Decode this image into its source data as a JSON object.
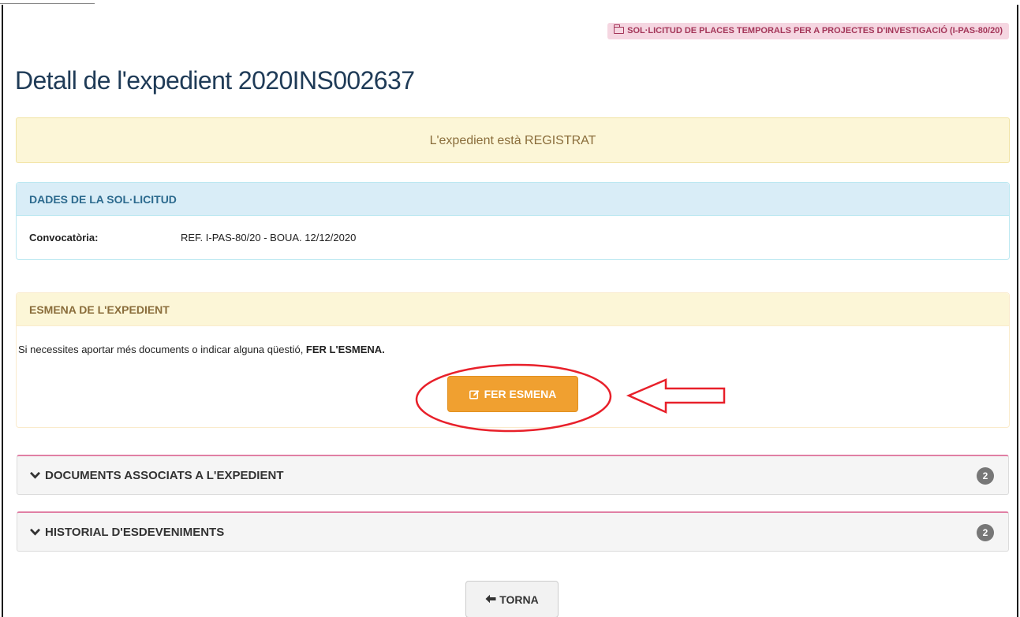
{
  "header": {
    "procedure_badge": "SOL·LICITUD DE PLACES TEMPORALS PER A PROJECTES D'INVESTIGACIÓ (I-PAS-80/20)",
    "badge_icon": "folder-open-icon",
    "page_title": "Detall de l'expedient 2020INS002637"
  },
  "status": {
    "text": "L'expedient està REGISTRAT"
  },
  "request_panel": {
    "title": "DADES DE LA SOL·LICITUD",
    "fields": [
      {
        "key": "Convocatòria:",
        "value": "REF. I-PAS-80/20 - BOUA. 12/12/2020"
      }
    ]
  },
  "amend_panel": {
    "title": "ESMENA DE L'EXPEDIENT",
    "message_pre": "Si necessites aportar més documents o indicar alguna qüestió, ",
    "message_bold": "FER L'ESMENA.",
    "button_label": "FER ESMENA",
    "button_icon": "edit-icon"
  },
  "accordions": [
    {
      "label": "DOCUMENTS ASSOCIATS A L'EXPEDIENT",
      "count": "2",
      "icon": "chevron-down-icon"
    },
    {
      "label": "HISTORIAL D'ESDEVENIMENTS",
      "count": "2",
      "icon": "chevron-down-icon"
    }
  ],
  "footer": {
    "back_label": "TORNA",
    "back_icon": "arrow-left-icon"
  },
  "colors": {
    "title": "#1f3b57",
    "badge_bg": "#f5d6e1",
    "badge_text": "#a43659",
    "info_header": "#d9edf7",
    "warn_header": "#fcf6d7",
    "button_orange": "#f0a030",
    "annotation_red": "#e8202a",
    "accordion_border": "#e07fa4"
  }
}
